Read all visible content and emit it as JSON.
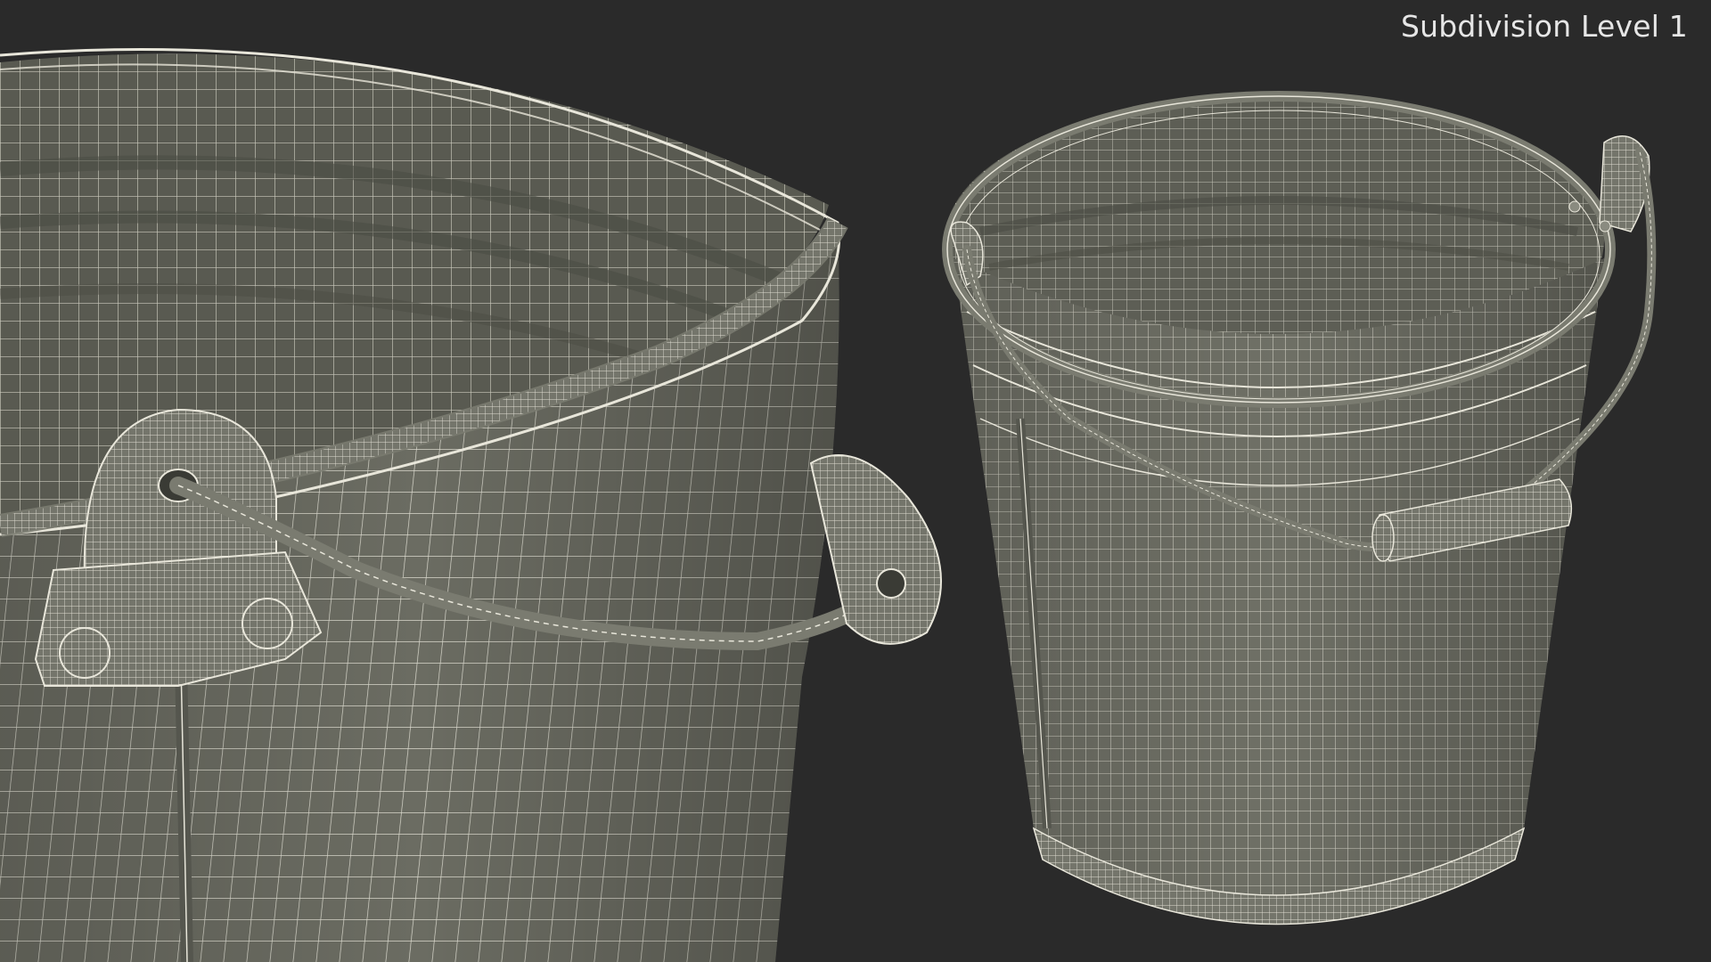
{
  "render": {
    "label": "Subdivision Level 1",
    "background_color": "#2a2a2a",
    "mesh_fill_color": "#6f7066",
    "mesh_shadow_color": "#55564e",
    "wire_color": "#e8e6da"
  }
}
